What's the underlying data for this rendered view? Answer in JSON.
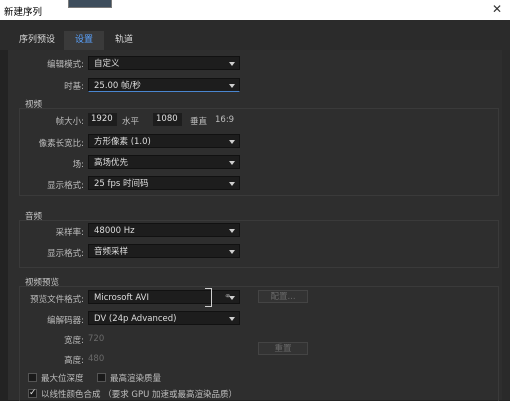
{
  "window": {
    "title": "新建序列",
    "close_glyph": "✕"
  },
  "tabs": [
    {
      "label": "序列预设",
      "active": false
    },
    {
      "label": "设置",
      "active": true
    },
    {
      "label": "轨道",
      "active": false
    }
  ],
  "top": {
    "edit_mode_label": "编辑模式:",
    "edit_mode_value": "自定义",
    "timebase_label": "时基:",
    "timebase_value": "25.00 帧/秒"
  },
  "video": {
    "section": "视频",
    "frame_size_label": "帧大小:",
    "width_value": "1920",
    "horizontal_label": "水平",
    "height_value": "1080",
    "vertical_label": "垂直",
    "aspect_text": "16:9",
    "pixel_aspect_label": "像素长宽比:",
    "pixel_aspect_value": "方形像素 (1.0)",
    "fields_label": "场:",
    "fields_value": "高场优先",
    "display_format_label": "显示格式:",
    "display_format_value": "25 fps 时间码"
  },
  "audio": {
    "section": "音频",
    "sample_rate_label": "采样率:",
    "sample_rate_value": "48000 Hz",
    "display_format_label": "显示格式:",
    "display_format_value": "音频采样"
  },
  "preview": {
    "section": "视频预览",
    "file_format_label": "预览文件格式:",
    "file_format_value": "Microsoft AVI",
    "configure_label": "配置...",
    "codec_label": "编解码器:",
    "codec_value": "DV (24p Advanced)",
    "width_label": "宽度:",
    "width_value": "720",
    "height_label": "高度:",
    "height_value": "480",
    "reset_label": "重置",
    "max_depth_label": "最大位深度",
    "max_quality_label": "最高渲染质量",
    "linear_color_label": "以线性颜色合成 （要求 GPU 加速或最高渲染品质）"
  },
  "colors": {
    "accent": "#5aa3ff",
    "background": "#2e2e2e"
  }
}
